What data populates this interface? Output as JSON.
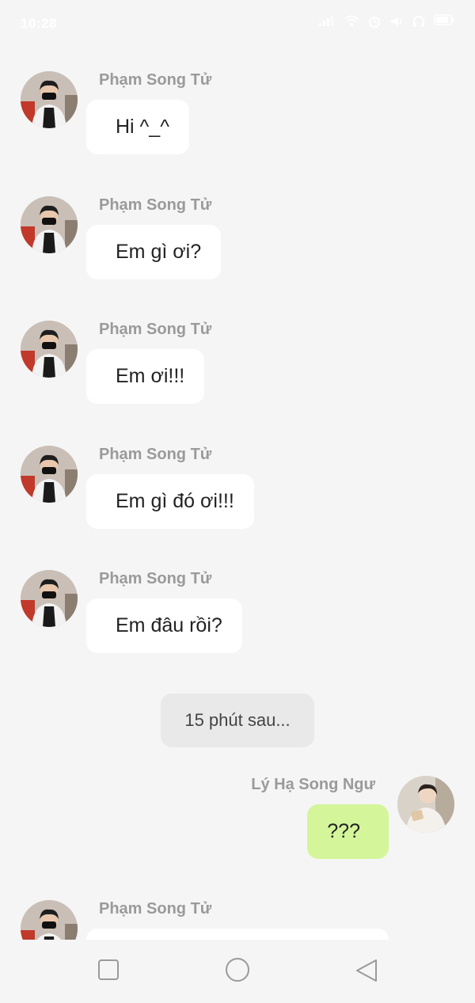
{
  "status_bar": {
    "time": "10:28",
    "icons": [
      "signal-icon",
      "wifi-icon",
      "alarm-icon",
      "sound-icon",
      "headphones-icon",
      "battery-icon"
    ]
  },
  "messages": [
    {
      "sender": "Phạm Song Tử",
      "text": "Hi ^_^",
      "side": "left",
      "avatar": "male-masked-avatar"
    },
    {
      "sender": "Phạm Song Tử",
      "text": "Em gì ơi?",
      "side": "left",
      "avatar": "male-masked-avatar"
    },
    {
      "sender": "Phạm Song Tử",
      "text": "Em ơi!!!",
      "side": "left",
      "avatar": "male-masked-avatar"
    },
    {
      "sender": "Phạm Song Tử",
      "text": "Em gì đó ơi!!!",
      "side": "left",
      "avatar": "male-masked-avatar"
    },
    {
      "sender": "Phạm Song Tử",
      "text": "Em đâu rồi?",
      "side": "left",
      "avatar": "male-masked-avatar"
    }
  ],
  "time_divider": "15 phút sau...",
  "reply": {
    "sender": "Lý Hạ Song Ngư",
    "text": "???",
    "side": "right",
    "avatar": "reader-avatar"
  },
  "last_message": {
    "sender": "Phạm Song Tử",
    "text": "",
    "side": "left",
    "avatar": "male-masked-avatar"
  },
  "colors": {
    "background": "#f5f5f5",
    "incoming_bubble": "#ffffff",
    "outgoing_bubble": "#d4f59a",
    "sender_name": "#9a9a9a"
  },
  "nav_bar": {
    "buttons": [
      "recents-square-icon",
      "home-circle-icon",
      "back-triangle-icon"
    ]
  }
}
